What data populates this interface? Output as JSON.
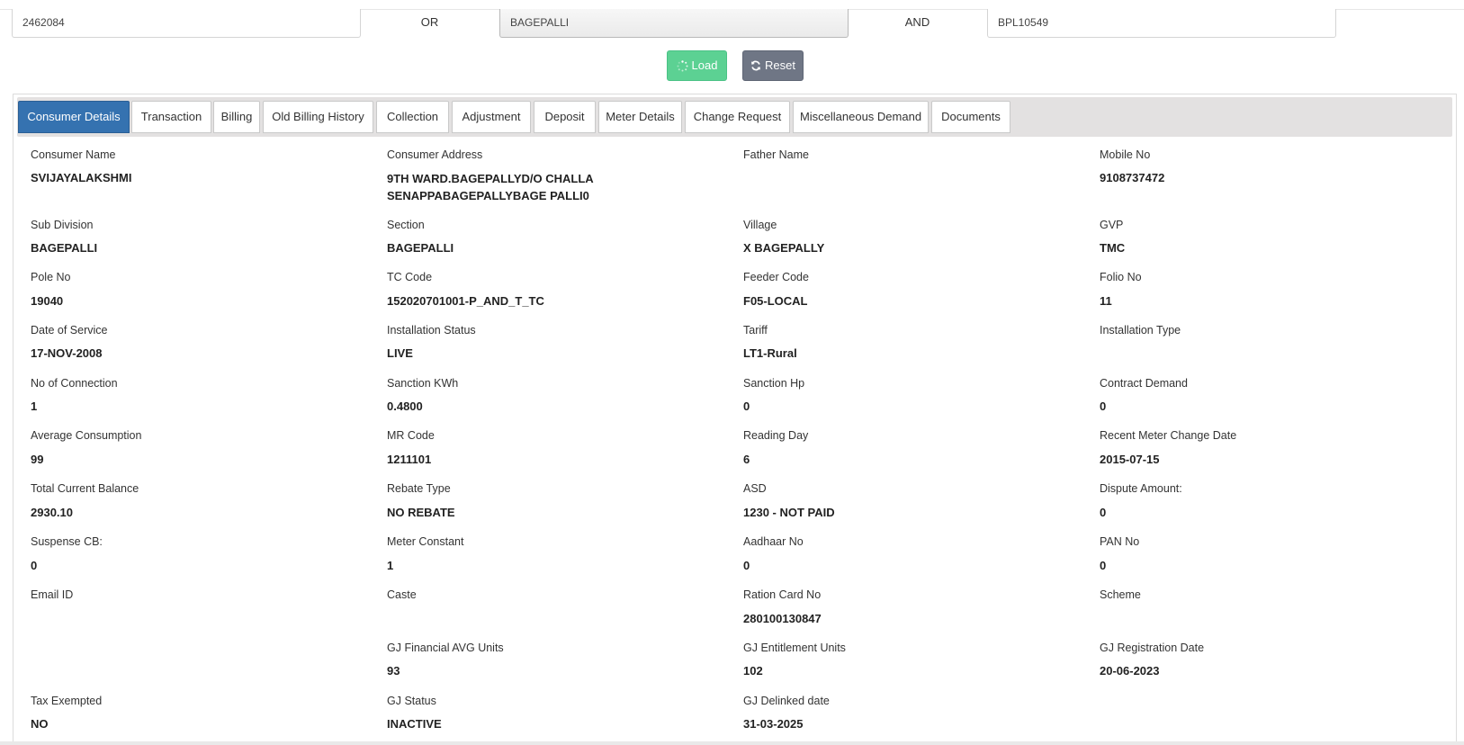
{
  "search": {
    "field1_value": "2462084",
    "or_label": "OR",
    "field2_value": "BAGEPALLI",
    "and_label": "AND",
    "field3_value": "BPL10549"
  },
  "buttons": {
    "load_label": "Load",
    "reset_label": "Reset",
    "load_color": "#5cd193",
    "reset_color": "#6f7685"
  },
  "tabs": [
    {
      "label": "Consumer Details",
      "active": true
    },
    {
      "label": "Transaction"
    },
    {
      "label": "Billing"
    },
    {
      "label": "Old Billing History"
    },
    {
      "label": "Collection"
    },
    {
      "label": "Adjustment"
    },
    {
      "label": "Deposit"
    },
    {
      "label": "Meter Details"
    },
    {
      "label": "Change Request"
    },
    {
      "label": "Miscellaneous Demand"
    },
    {
      "label": "Documents"
    }
  ],
  "accent_color": "#3572b0",
  "details": {
    "consumer_name": {
      "label": "Consumer Name",
      "value": "SVIJAYALAKSHMI"
    },
    "consumer_address": {
      "label": "Consumer Address",
      "value": "9TH WARD.BAGEPALLYD/O CHALLA SENAPPABAGEPALLYBAGE PALLI0"
    },
    "father_name": {
      "label": "Father Name",
      "value": ""
    },
    "mobile_no": {
      "label": "Mobile No",
      "value": "9108737472"
    },
    "sub_division": {
      "label": "Sub Division",
      "value": "BAGEPALLI"
    },
    "section": {
      "label": "Section",
      "value": "BAGEPALLI"
    },
    "village": {
      "label": "Village",
      "value": "X BAGEPALLY"
    },
    "gvp": {
      "label": "GVP",
      "value": "TMC"
    },
    "pole_no": {
      "label": "Pole No",
      "value": "19040"
    },
    "tc_code": {
      "label": "TC Code",
      "value": "152020701001-P_AND_T_TC"
    },
    "feeder_code": {
      "label": "Feeder Code",
      "value": "F05-LOCAL"
    },
    "folio_no": {
      "label": "Folio No",
      "value": "11"
    },
    "date_of_service": {
      "label": "Date of Service",
      "value": "17-NOV-2008"
    },
    "installation_status": {
      "label": "Installation Status",
      "value": "LIVE"
    },
    "tariff": {
      "label": "Tariff",
      "value": "LT1-Rural"
    },
    "installation_type": {
      "label": "Installation Type",
      "value": ""
    },
    "no_of_connection": {
      "label": "No of Connection",
      "value": "1"
    },
    "sanction_kwh": {
      "label": "Sanction KWh",
      "value": "0.4800"
    },
    "sanction_hp": {
      "label": "Sanction Hp",
      "value": "0"
    },
    "contract_demand": {
      "label": "Contract Demand",
      "value": "0"
    },
    "average_consumption": {
      "label": "Average Consumption",
      "value": "99"
    },
    "mr_code": {
      "label": "MR Code",
      "value": "1211101"
    },
    "reading_day": {
      "label": "Reading Day",
      "value": "6"
    },
    "recent_meter_change_date": {
      "label": "Recent Meter Change Date",
      "value": "2015-07-15"
    },
    "total_current_balance": {
      "label": "Total Current Balance",
      "value": "2930.10"
    },
    "rebate_type": {
      "label": "Rebate Type",
      "value": "NO REBATE"
    },
    "asd": {
      "label": "ASD",
      "value": "1230 - NOT PAID"
    },
    "dispute_amount": {
      "label": "Dispute Amount:",
      "value": "0"
    },
    "suspense_cb": {
      "label": "Suspense CB:",
      "value": "0"
    },
    "meter_constant": {
      "label": "Meter Constant",
      "value": "1"
    },
    "aadhaar_no": {
      "label": "Aadhaar No",
      "value": "0"
    },
    "pan_no": {
      "label": "PAN No",
      "value": "0"
    },
    "email_id": {
      "label": "Email ID",
      "value": ""
    },
    "caste": {
      "label": "Caste",
      "value": ""
    },
    "ration_card_no": {
      "label": "Ration Card No",
      "value": "280100130847"
    },
    "scheme": {
      "label": "Scheme",
      "value": ""
    },
    "gj_financial_avg_units": {
      "label": "GJ Financial AVG Units",
      "value": "93"
    },
    "gj_entitlement_units": {
      "label": "GJ Entitlement Units",
      "value": "102"
    },
    "gj_registration_date": {
      "label": "GJ Registration Date",
      "value": "20-06-2023"
    },
    "tax_exempted": {
      "label": "Tax Exempted",
      "value": "NO"
    },
    "gj_status": {
      "label": "GJ Status",
      "value": "INACTIVE"
    },
    "gj_delinked_date": {
      "label": "GJ Delinked date",
      "value": "31-03-2025"
    }
  }
}
